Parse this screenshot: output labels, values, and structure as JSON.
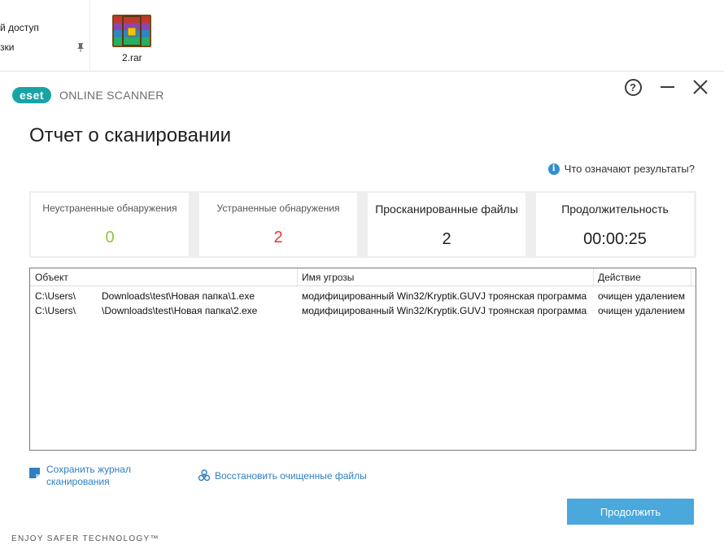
{
  "explorer": {
    "nav_items": [
      "й доступ",
      "зки"
    ],
    "file_name": "2.rar",
    "rar_colors": [
      "#c0392b",
      "#2e86c1",
      "#27ae60",
      "#8e44ad",
      "#f1c40f"
    ]
  },
  "window": {
    "logo_brand": "eset",
    "logo_product": "ONLINE SCANNER",
    "help_icon": "?",
    "title": "Отчет о сканировании",
    "results_help": "Что означают результаты?"
  },
  "stats": [
    {
      "label": "Неустраненные обнаружения",
      "value": "0",
      "color": "#8cc63f"
    },
    {
      "label": "Устраненные обнаружения",
      "value": "2",
      "color": "#e53935"
    },
    {
      "label": "Просканированные файлы",
      "value": "2"
    },
    {
      "label": "Продолжительность",
      "value": "00:00:25"
    }
  ],
  "table": {
    "headers": [
      "Объект",
      "Имя угрозы",
      "Действие"
    ],
    "rows": [
      {
        "obj_start": "C:\\Users\\",
        "obj_end": "Downloads\\test\\Новая папка\\1.exe",
        "threat": "модифицированный Win32/Kryptik.GUVJ троянская программа",
        "action": "очищен удалением"
      },
      {
        "obj_start": "C:\\Users\\",
        "obj_end": "\\Downloads\\test\\Новая папка\\2.exe",
        "threat": "модифицированный Win32/Kryptik.GUVJ троянская программа",
        "action": "очищен удалением"
      }
    ]
  },
  "links": {
    "save_log": "Сохранить журнал сканирования",
    "restore": "Восстановить очищенные файлы"
  },
  "continue_label": "Продолжить",
  "tagline": "ENJOY SAFER TECHNOLOGY™",
  "colors": {
    "brand": "#19a3a6",
    "link": "#2f7fc1",
    "button": "#4aa8dc"
  }
}
